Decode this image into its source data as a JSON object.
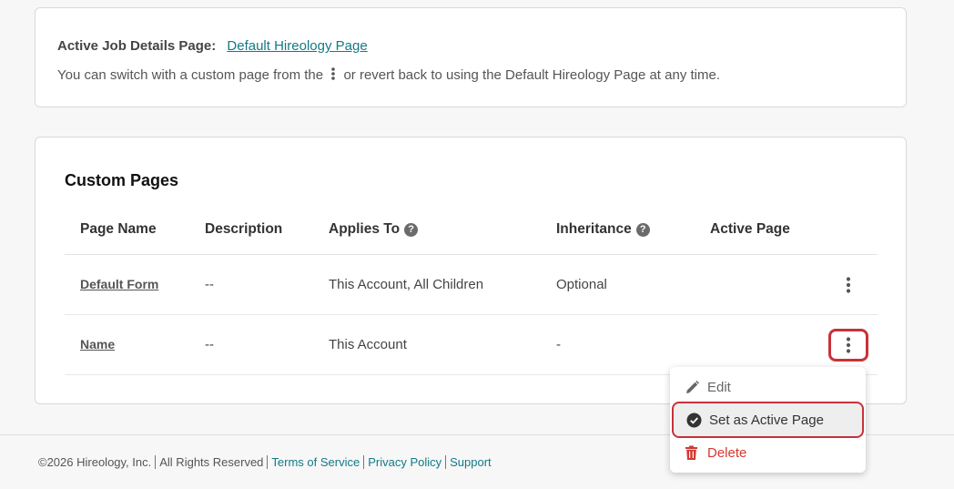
{
  "active_page": {
    "label": "Active Job Details Page:",
    "link": "Default Hireology Page",
    "hint_before": "You can switch with a custom page from the",
    "hint_after": "or revert back to using the Default Hireology Page at any time."
  },
  "custom_pages": {
    "title": "Custom Pages",
    "columns": {
      "page_name": "Page Name",
      "description": "Description",
      "applies_to": "Applies To",
      "inheritance": "Inheritance",
      "active_page": "Active Page"
    },
    "rows": [
      {
        "name": "Default Form",
        "description": "--",
        "applies_to": "This Account, All Children",
        "inheritance": "Optional"
      },
      {
        "name": "Name",
        "description": "--",
        "applies_to": "This Account",
        "inheritance": "-"
      }
    ]
  },
  "menu": {
    "edit": "Edit",
    "set_active": "Set as Active Page",
    "delete": "Delete"
  },
  "footer": {
    "copyright": "©2026 Hireology, Inc.",
    "rights": "All Rights Reserved",
    "terms": "Terms of Service",
    "privacy": "Privacy Policy",
    "support": "Support"
  },
  "colors": {
    "accent_link": "#137a86",
    "highlight_border": "#c8323a",
    "delete": "#d43a32"
  },
  "icons": {
    "help": "question-circle-icon",
    "kebab": "vertical-ellipsis-icon",
    "edit": "pencil-icon",
    "set_active": "check-circle-icon",
    "delete": "trash-icon"
  }
}
